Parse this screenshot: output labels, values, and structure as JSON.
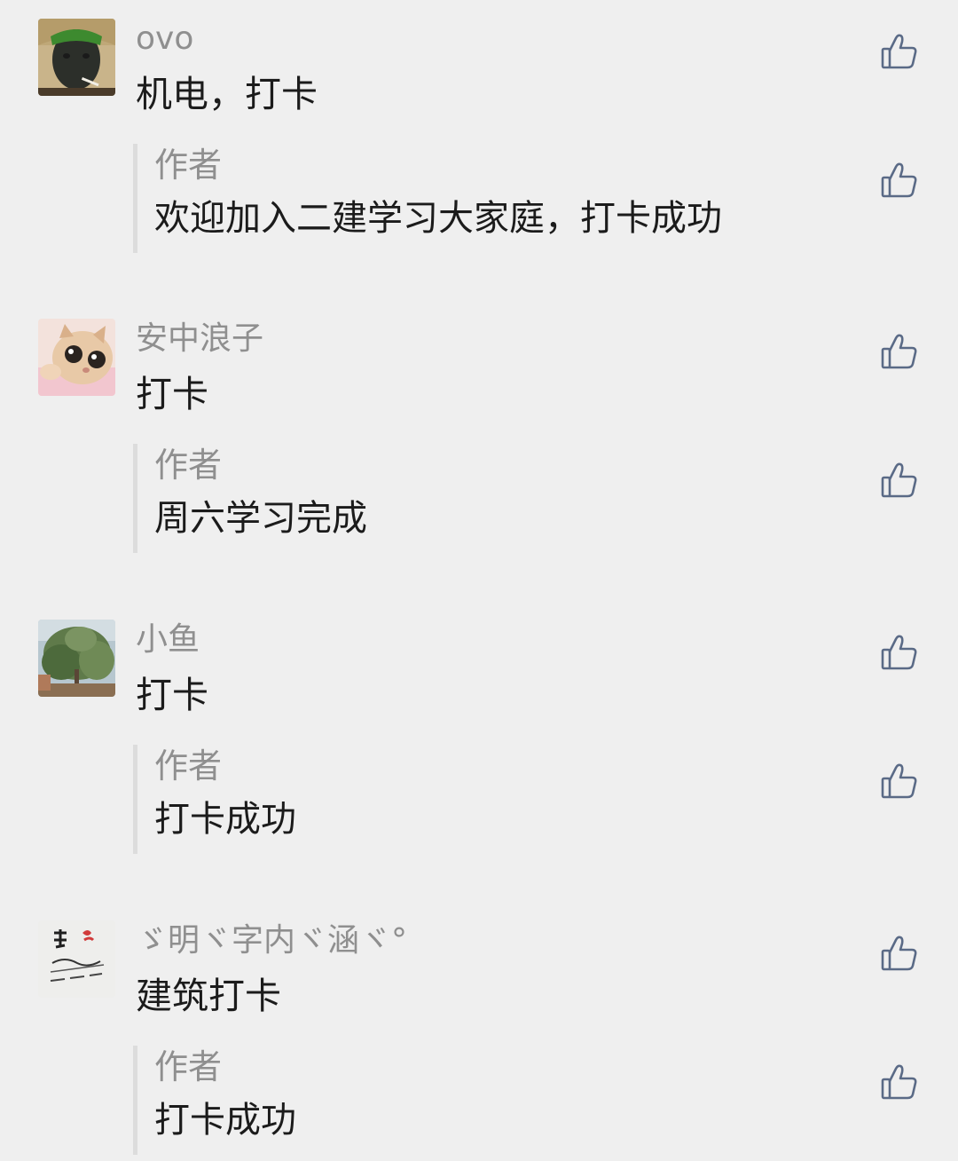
{
  "colors": {
    "background": "#efefef",
    "nickname": "#8f8f8f",
    "text": "#1b1b1b",
    "reply_bar": "#dcdcdc",
    "like_icon": "#5a6a86"
  },
  "comments": [
    {
      "avatar": "avatar-man-portrait",
      "nickname": "ovo",
      "text": "机电，打卡",
      "like_icon": "thumbs-up-icon",
      "reply": {
        "author": "作者",
        "text": "欢迎加入二建学习大家庭，打卡成功",
        "like_icon": "thumbs-up-icon"
      }
    },
    {
      "avatar": "avatar-cat",
      "nickname": "安中浪子",
      "text": "打卡",
      "like_icon": "thumbs-up-icon",
      "reply": {
        "author": "作者",
        "text": "周六学习完成",
        "like_icon": "thumbs-up-icon"
      }
    },
    {
      "avatar": "avatar-tree",
      "nickname": "小鱼",
      "text": "打卡",
      "like_icon": "thumbs-up-icon",
      "reply": {
        "author": "作者",
        "text": "打卡成功",
        "like_icon": "thumbs-up-icon"
      }
    },
    {
      "avatar": "avatar-calligraphy",
      "nickname": "ゞ明ヾ字内ヾ涵ヾ°",
      "text": "建筑打卡",
      "like_icon": "thumbs-up-icon",
      "reply": {
        "author": "作者",
        "text": "打卡成功",
        "like_icon": "thumbs-up-icon"
      }
    }
  ]
}
